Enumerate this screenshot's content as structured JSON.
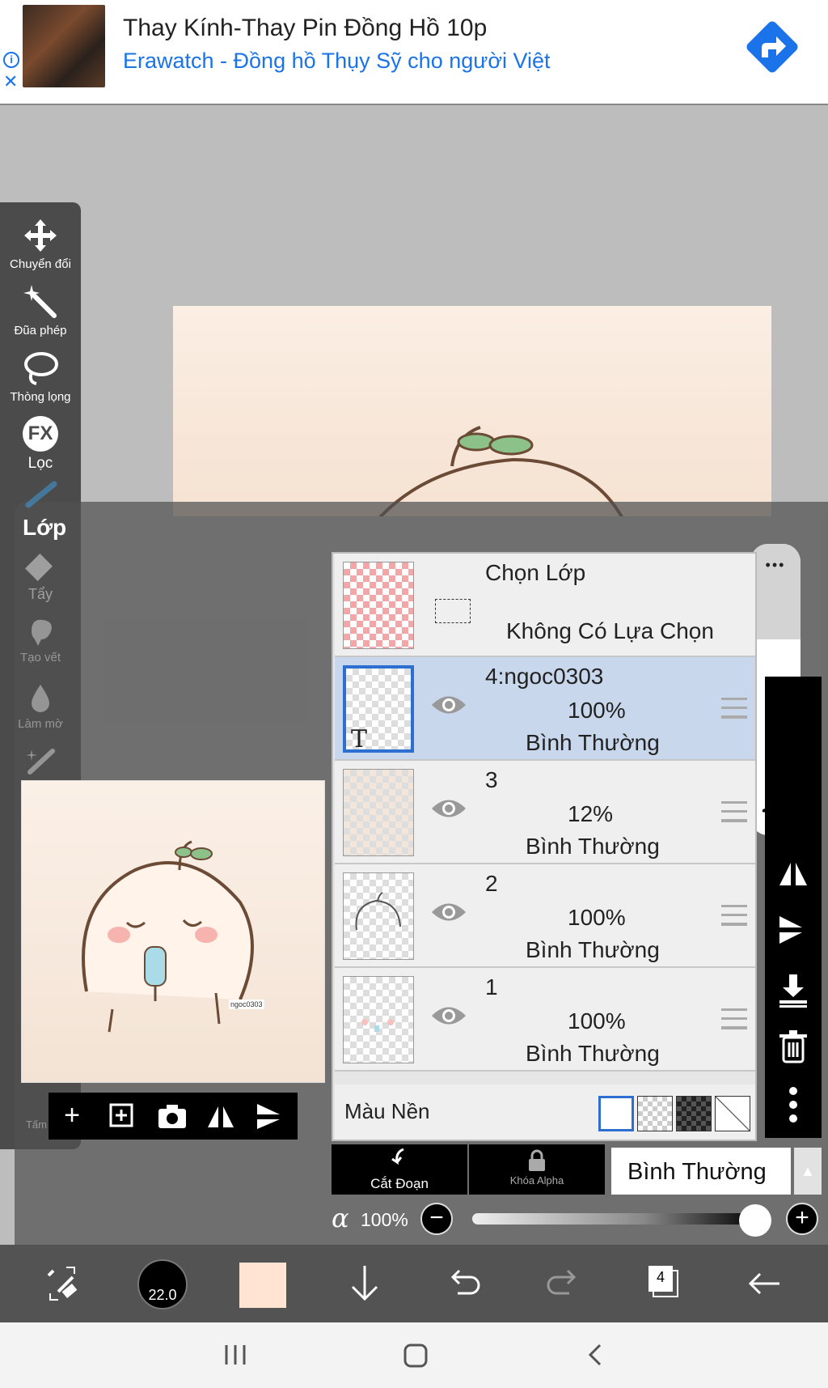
{
  "ad": {
    "title": "Thay Kính-Thay Pin Đồng Hồ 10p",
    "subtitle": "Erawatch - Đồng hồ Thụy Sỹ cho người Việt"
  },
  "toolbar": {
    "items": [
      {
        "label": "Chuyển đổi",
        "icon": "move-icon"
      },
      {
        "label": "Đũa phép",
        "icon": "magic-wand-icon"
      },
      {
        "label": "Thòng lọng",
        "icon": "lasso-icon"
      },
      {
        "label": "Lọc",
        "icon": "fx-icon",
        "glyph": "FX"
      },
      {
        "label": "Tẩy",
        "icon": "eraser-icon"
      },
      {
        "label": "Tạo vết",
        "icon": "smudge-icon"
      },
      {
        "label": "Làm mờ",
        "icon": "blur-icon"
      },
      {
        "label": "Tấm v",
        "icon": "canvas-icon"
      }
    ]
  },
  "layer_panel": {
    "title": "Lớp",
    "selection": {
      "title": "Chọn Lớp",
      "status": "Không Có Lựa Chọn"
    },
    "layers": [
      {
        "name": "4:ngoc0303",
        "opacity": "100%",
        "mode": "Bình Thường",
        "selected": true,
        "thumb_glyph": "T"
      },
      {
        "name": "3",
        "opacity": "12%",
        "mode": "Bình Thường",
        "selected": false
      },
      {
        "name": "2",
        "opacity": "100%",
        "mode": "Bình Thường",
        "selected": false
      },
      {
        "name": "1",
        "opacity": "100%",
        "mode": "Bình Thường",
        "selected": false
      }
    ],
    "background": {
      "label": "Màu Nền"
    },
    "more_glyph": "•••"
  },
  "preview": {
    "watermark": "ngoc0303"
  },
  "bottom_panel": {
    "clip_label": "Cắt Đoạn",
    "alpha_lock_label": "Khóa Alpha",
    "blend_mode": "Bình Thường",
    "alpha_symbol": "α",
    "opacity": "100%",
    "opacity_fraction": 1.0
  },
  "bottom_bar": {
    "brush_size": "22.0",
    "color": "#ffe3d3",
    "layer_count": "4"
  },
  "colors": {
    "accent": "#2c6fd1",
    "ad_link": "#1a73e8",
    "toolbar_bg": "#4b4b4b",
    "selected_row": "#c9d7ec"
  }
}
